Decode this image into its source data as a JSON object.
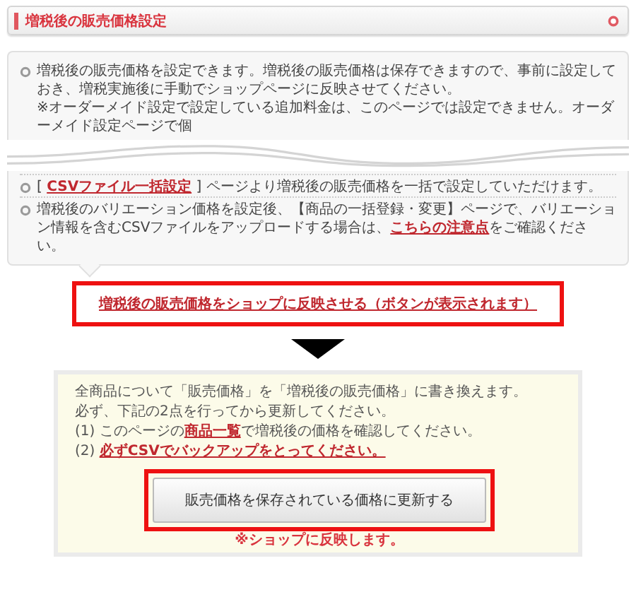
{
  "header": {
    "title": "増税後の販売価格設定"
  },
  "intro_box": {
    "items": [
      {
        "parts": [
          {
            "kind": "text",
            "text": "増税後の販売価格を設定できます。増税後の販売価格は保存できますので、事前に設定しておき、増税実施後に手動でショップページに反映させてください。"
          }
        ]
      },
      {
        "parts": [
          {
            "kind": "note",
            "text": "※オーダーメイド設定で設定している追加料金は、このページでは設定できません。オーダーメイド設定ページで個"
          }
        ]
      }
    ]
  },
  "info_box": {
    "items": [
      {
        "parts": [
          {
            "kind": "text",
            "text": "[ "
          },
          {
            "kind": "link",
            "text": "CSVファイル一括設定"
          },
          {
            "kind": "text",
            "text": " ] ページより増税後の販売価格を一括で設定していただけます。"
          }
        ]
      },
      {
        "parts": [
          {
            "kind": "text",
            "text": "増税後のバリエーション価格を設定後、【商品の一括登録・変更】ページで、バリエーション情報を含むCSVファイルをアップロードする場合は、"
          },
          {
            "kind": "link",
            "text": "こちらの注意点"
          },
          {
            "kind": "text",
            "text": "をご確認ください。"
          }
        ]
      }
    ]
  },
  "reflect_link": {
    "text": "増税後の販売価格をショップに反映させる（ボタンが表示されます）"
  },
  "confirm_panel": {
    "lines": [
      {
        "parts": [
          {
            "kind": "text",
            "text": "全商品について「販売価格」を「増税後の販売価格」に書き換えます。"
          }
        ]
      },
      {
        "parts": [
          {
            "kind": "text",
            "text": "必ず、下記の2点を行ってから更新してください。"
          }
        ]
      },
      {
        "parts": [
          {
            "kind": "text",
            "text": "(1) このページの"
          },
          {
            "kind": "link",
            "text": "商品一覧"
          },
          {
            "kind": "text",
            "text": "で増税後の価格を確認してください。"
          }
        ]
      },
      {
        "parts": [
          {
            "kind": "text",
            "text": "(2) "
          },
          {
            "kind": "link",
            "text": "必ずCSVでバックアップをとってください。"
          }
        ]
      }
    ],
    "button": "販売価格を保存されている価格に更新する",
    "note": "※ショップに反映します。"
  }
}
